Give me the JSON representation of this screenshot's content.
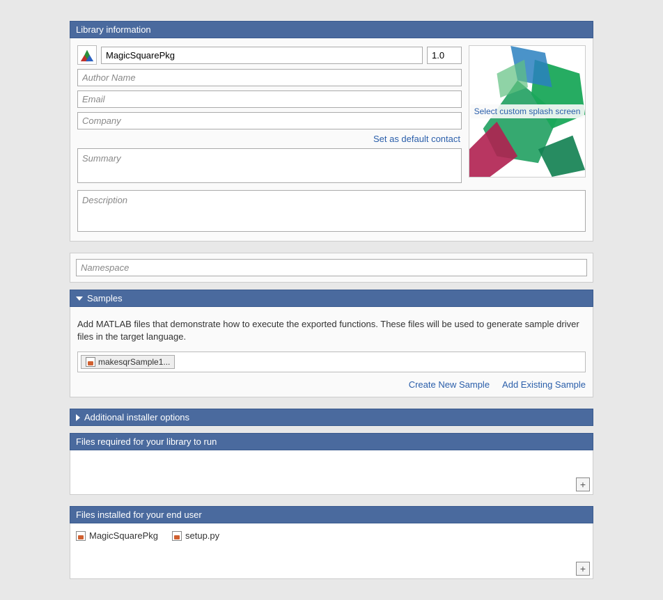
{
  "library_info": {
    "header": "Library information",
    "name": "MagicSquarePkg",
    "version": "1.0",
    "author_placeholder": "Author Name",
    "email_placeholder": "Email",
    "company_placeholder": "Company",
    "set_default_contact": "Set as default contact",
    "summary_placeholder": "Summary",
    "description_placeholder": "Description",
    "splash_label": "Select custom splash screen"
  },
  "namespace": {
    "placeholder": "Namespace"
  },
  "samples": {
    "header": "Samples",
    "description": "Add MATLAB files that demonstrate how to execute the exported functions.  These files will be used to generate sample driver files in the target language.",
    "items": [
      "makesqrSample1..."
    ],
    "create_new": "Create New Sample",
    "add_existing": "Add Existing Sample"
  },
  "additional_installer": {
    "header": "Additional installer options"
  },
  "files_required": {
    "header": "Files required for your library to run"
  },
  "files_installed": {
    "header": "Files installed for your end user",
    "items": [
      "MagicSquarePkg",
      "setup.py"
    ]
  }
}
